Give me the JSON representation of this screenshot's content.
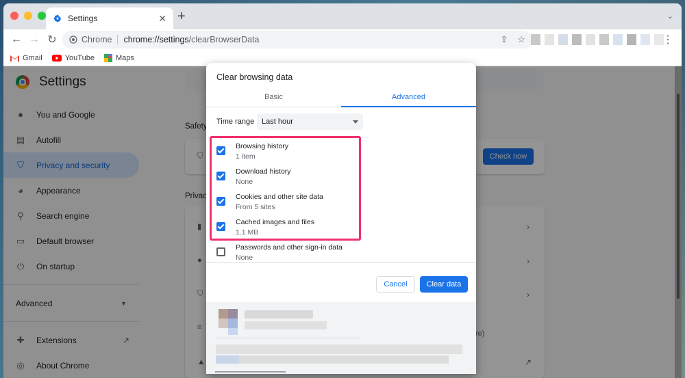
{
  "browser": {
    "tab_title": "Settings",
    "omnibox_chrome_label": "Chrome",
    "url_host": "chrome://settings",
    "url_path": "/clearBrowserData",
    "bookmarks": [
      {
        "label": "Gmail",
        "icon": "gmail-icon"
      },
      {
        "label": "YouTube",
        "icon": "youtube-icon"
      },
      {
        "label": "Maps",
        "icon": "maps-icon"
      }
    ]
  },
  "settings": {
    "title": "Settings",
    "sidebar": [
      {
        "label": "You and Google",
        "icon": "person-icon"
      },
      {
        "label": "Autofill",
        "icon": "clipboard-icon"
      },
      {
        "label": "Privacy and security",
        "icon": "shield-icon",
        "active": true
      },
      {
        "label": "Appearance",
        "icon": "palette-icon"
      },
      {
        "label": "Search engine",
        "icon": "search-icon"
      },
      {
        "label": "Default browser",
        "icon": "browser-icon"
      },
      {
        "label": "On startup",
        "icon": "power-icon"
      }
    ],
    "advanced_label": "Advanced",
    "extensions_label": "Extensions",
    "about_label": "About Chrome",
    "safety_label": "Safety",
    "privacy_label": "Privac",
    "check_now_label": "Check now",
    "bg_fragment": "re)"
  },
  "dialog": {
    "title": "Clear browsing data",
    "tabs": [
      "Basic",
      "Advanced"
    ],
    "active_tab": "Advanced",
    "time_range_label": "Time range",
    "time_range_value": "Last hour",
    "options": [
      {
        "title": "Browsing history",
        "sub": "1 item",
        "checked": true
      },
      {
        "title": "Download history",
        "sub": "None",
        "checked": true
      },
      {
        "title": "Cookies and other site data",
        "sub": "From 5 sites",
        "checked": true
      },
      {
        "title": "Cached images and files",
        "sub": "1.1 MB",
        "checked": true
      },
      {
        "title": "Passwords and other sign-in data",
        "sub": "None",
        "checked": false
      }
    ],
    "cancel_label": "Cancel",
    "clear_label": "Clear data"
  },
  "colors": {
    "accent": "#1a73e8",
    "highlight": "#f0306b",
    "sidebar_active_bg": "#d2e3fc"
  }
}
